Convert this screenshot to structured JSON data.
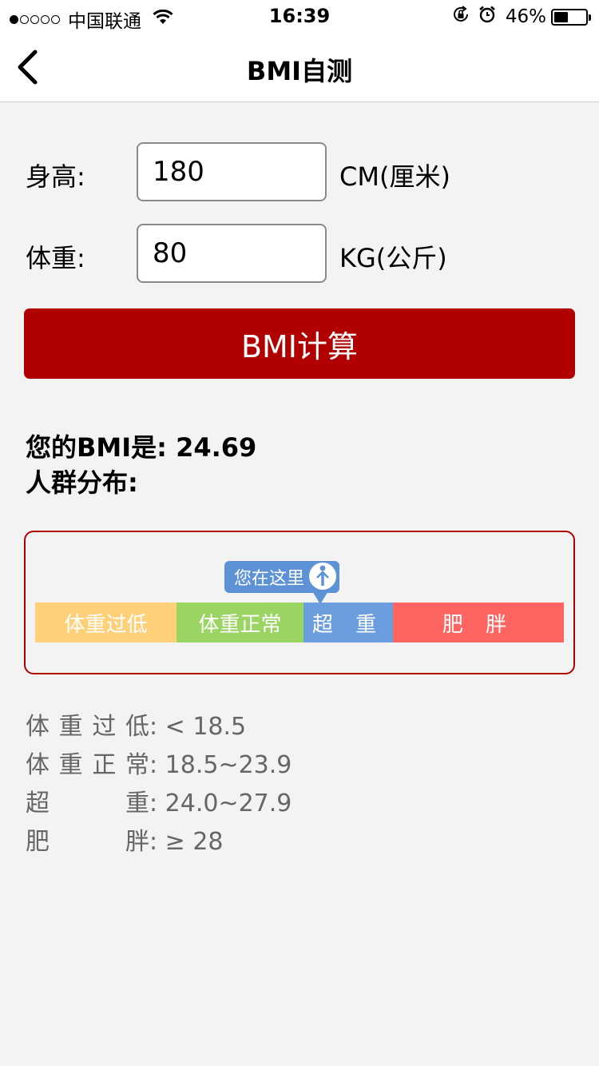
{
  "status_bar": {
    "signal_dots": [
      true,
      false,
      false,
      false,
      false
    ],
    "carrier": "中国联通",
    "time": "16:39",
    "battery_percent": "46%",
    "battery_level": 0.46,
    "icons": [
      "wifi-icon",
      "orientation-lock-icon",
      "alarm-icon",
      "battery-icon"
    ]
  },
  "nav": {
    "title": "BMI自测",
    "back_icon": "chevron-left-icon"
  },
  "form": {
    "height_label": "身高:",
    "height_value": "180",
    "height_unit": "CM(厘米)",
    "weight_label": "体重:",
    "weight_value": "80",
    "weight_unit": "KG(公斤)"
  },
  "calc_button": "BMI计算",
  "result": {
    "bmi_line": "您的BMI是: 24.69",
    "distribution_label": "人群分布:"
  },
  "distribution": {
    "marker": "您在这里",
    "segments": [
      "体重过低",
      "体重正常",
      "超 重",
      "肥 胖"
    ]
  },
  "legend": [
    {
      "name": "体重过低",
      "range": "< 18.5"
    },
    {
      "name": "体重正常",
      "range": "18.5~23.9"
    },
    {
      "name": "超 重",
      "range": "24.0~27.9"
    },
    {
      "name": "肥 胖",
      "range": "≥ 28"
    }
  ],
  "colors": {
    "accent": "#b10000",
    "underweight": "#fdd079",
    "normal": "#9ad463",
    "overweight": "#6c9ddf",
    "obese": "#fd6563",
    "marker": "#5d92d7"
  }
}
